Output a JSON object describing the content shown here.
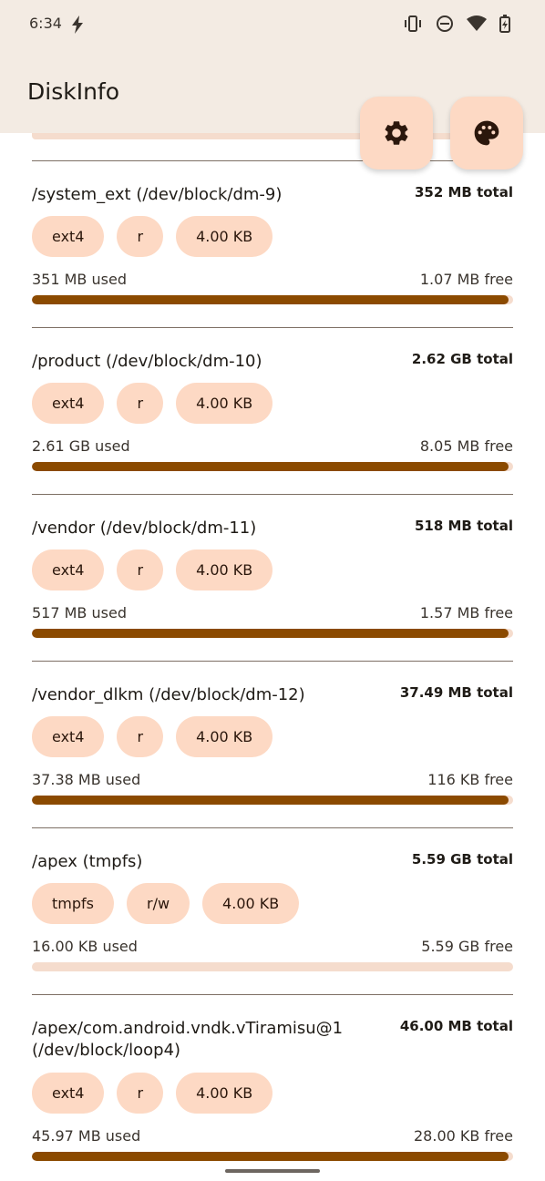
{
  "status": {
    "time": "6:34"
  },
  "app": {
    "title": "DiskInfo"
  },
  "entries": [
    {
      "mount": "/system_ext (/dev/block/dm-9)",
      "total": "352 MB total",
      "chips": [
        "ext4",
        "r",
        "4.00 KB"
      ],
      "used": "351 MB used",
      "free": "1.07 MB free",
      "used_fraction": 0.99
    },
    {
      "mount": "/product (/dev/block/dm-10)",
      "total": "2.62 GB total",
      "chips": [
        "ext4",
        "r",
        "4.00 KB"
      ],
      "used": "2.61 GB used",
      "free": "8.05 MB free",
      "used_fraction": 0.99
    },
    {
      "mount": "/vendor (/dev/block/dm-11)",
      "total": "518 MB total",
      "chips": [
        "ext4",
        "r",
        "4.00 KB"
      ],
      "used": "517 MB used",
      "free": "1.57 MB free",
      "used_fraction": 0.99
    },
    {
      "mount": "/vendor_dlkm (/dev/block/dm-12)",
      "total": "37.49 MB total",
      "chips": [
        "ext4",
        "r",
        "4.00 KB"
      ],
      "used": "37.38 MB used",
      "free": "116 KB free",
      "used_fraction": 0.99
    },
    {
      "mount": "/apex (tmpfs)",
      "total": "5.59 GB total",
      "chips": [
        "tmpfs",
        "r/w",
        "4.00 KB"
      ],
      "used": "16.00 KB used",
      "free": "5.59 GB free",
      "used_fraction": 0.0
    },
    {
      "mount": "/apex/com.android.vndk.vTiramisu@1 (/dev/block/loop4)",
      "total": "46.00 MB total",
      "chips": [
        "ext4",
        "r",
        "4.00 KB"
      ],
      "used": "45.97 MB used",
      "free": "28.00 KB free",
      "used_fraction": 0.99
    }
  ],
  "colors": {
    "accent": "#8b4a00",
    "chip": "#fdd9c4",
    "track": "#f5dccd",
    "header": "#f3ebe3"
  },
  "icons": {
    "settings": "gear-icon",
    "palette": "palette-icon"
  }
}
